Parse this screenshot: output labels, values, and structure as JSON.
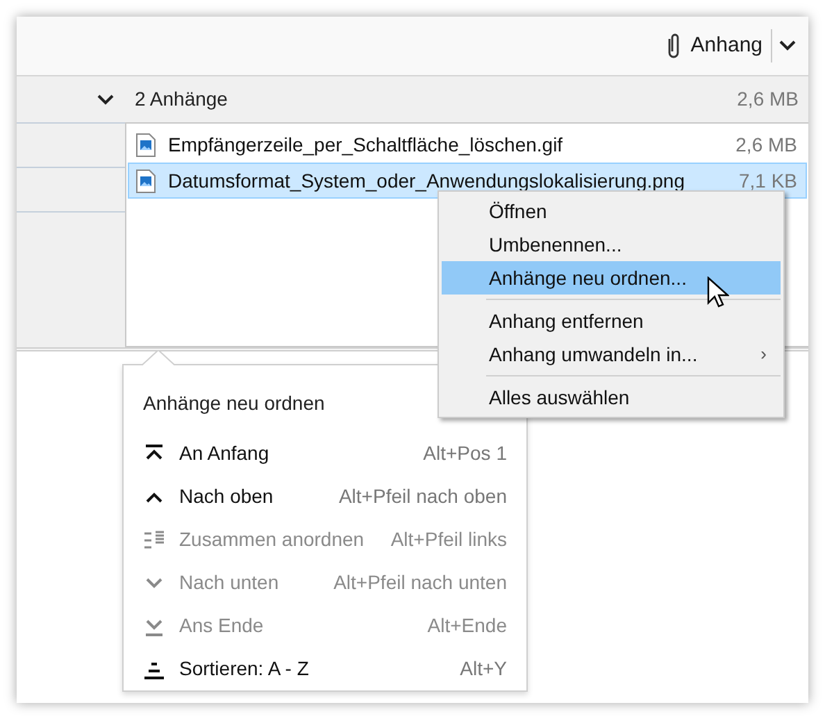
{
  "toolbar": {
    "attach_button": {
      "label": "Anhang"
    }
  },
  "attachments": {
    "header": "2 Anhänge",
    "total_size": "2,6 MB",
    "files": [
      {
        "name": "Empfängerzeile_per_Schaltfläche_löschen.gif",
        "size": "2,6 MB",
        "selected": false
      },
      {
        "name": "Datumsformat_System_oder_Anwendungslokalisierung.png",
        "size": "7,1 KB",
        "selected": true
      }
    ]
  },
  "context_menu": [
    {
      "kind": "item",
      "label": "Öffnen",
      "selected": false
    },
    {
      "kind": "item",
      "label": "Umbenennen...",
      "selected": false
    },
    {
      "kind": "item",
      "label": "Anhänge neu ordnen...",
      "selected": true
    },
    {
      "kind": "separator"
    },
    {
      "kind": "item",
      "label": "Anhang entfernen",
      "selected": false
    },
    {
      "kind": "submenu",
      "label": "Anhang umwandeln in...",
      "arrow": "›",
      "selected": false
    },
    {
      "kind": "separator"
    },
    {
      "kind": "item",
      "label": "Alles auswählen",
      "selected": false
    }
  ],
  "reorder_panel": {
    "title": "Anhänge neu ordnen",
    "items": [
      {
        "label": "An Anfang",
        "shortcut": "Alt+Pos 1",
        "disabled": false
      },
      {
        "label": "Nach oben",
        "shortcut": "Alt+Pfeil nach oben",
        "disabled": false
      },
      {
        "label": "Zusammen anordnen",
        "shortcut": "Alt+Pfeil links",
        "disabled": true
      },
      {
        "label": "Nach unten",
        "shortcut": "Alt+Pfeil nach unten",
        "disabled": true
      },
      {
        "label": "Ans Ende",
        "shortcut": "Alt+Ende",
        "disabled": true
      },
      {
        "label": "Sortieren: A - Z",
        "shortcut": "Alt+Y",
        "disabled": false
      }
    ]
  }
}
